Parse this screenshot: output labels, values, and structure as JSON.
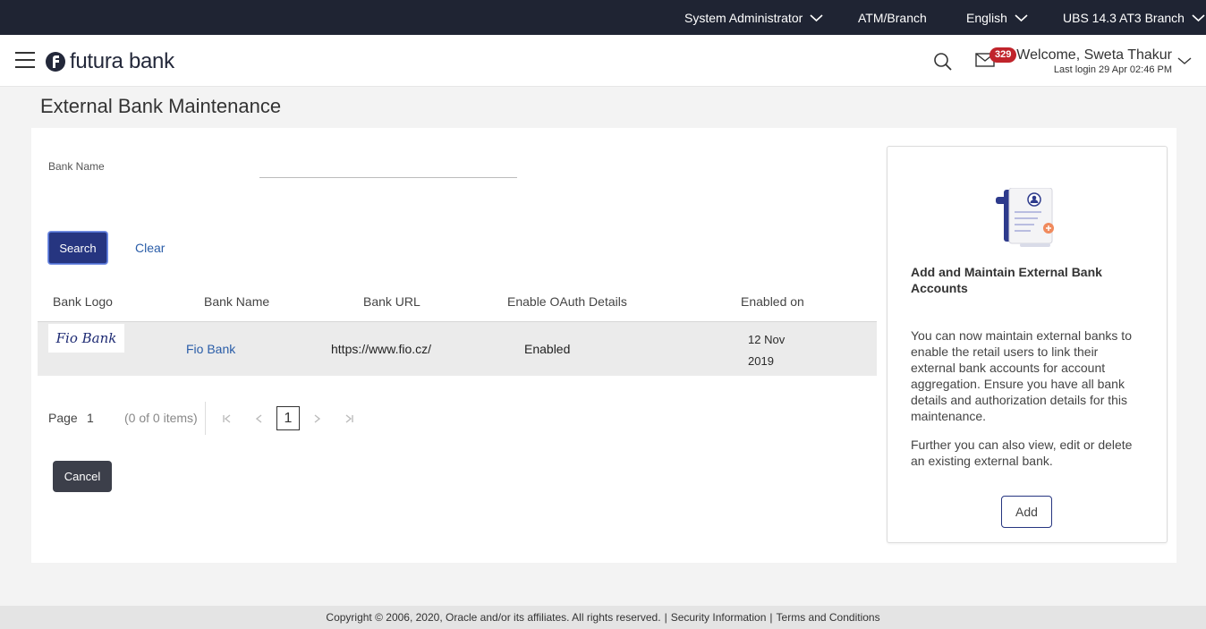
{
  "topbar": {
    "role": "System Administrator",
    "branch": "ATM/Branch",
    "language": "English",
    "entity": "UBS 14.3 AT3 Branch"
  },
  "header": {
    "brand": "futura bank",
    "mail_count": "329",
    "welcome": "Welcome, Sweta Thakur",
    "last_login": "Last login 29 Apr 02:46 PM"
  },
  "page": {
    "title": "External Bank Maintenance"
  },
  "form": {
    "bank_name_label": "Bank Name",
    "bank_name_value": "",
    "search_label": "Search",
    "clear_label": "Clear"
  },
  "table": {
    "columns": [
      "Bank Logo",
      "Bank Name",
      "Bank URL",
      "Enable OAuth Details",
      "Enabled on"
    ],
    "rows": [
      {
        "logo_text": "Fio Bank",
        "bank_name": "Fio Bank",
        "url": "https://www.fio.cz/",
        "oauth": "Enabled",
        "enabled_on_date": "12 Nov",
        "enabled_on_year": "2019"
      }
    ]
  },
  "pagination": {
    "page_label": "Page",
    "page": "1",
    "items": "(0 of 0 items)",
    "current": "1"
  },
  "actions": {
    "cancel_label": "Cancel"
  },
  "side_card": {
    "title": "Add and Maintain External Bank Accounts",
    "text1": "You can now maintain external banks to enable the retail users to link their external bank accounts for account aggregation. Ensure you have all bank details and authorization details for this maintenance.",
    "text2": "Further you can also view, edit or delete an existing external bank.",
    "add_label": "Add"
  },
  "footer": {
    "copyright": "Copyright © 2006, 2020, Oracle and/or its affiliates. All rights reserved.",
    "security": "Security Information",
    "terms": "Terms and Conditions"
  },
  "colors": {
    "topbar": "#1f2433",
    "primary": "#263580",
    "link": "#2a5da8",
    "badge": "#c0242b"
  }
}
